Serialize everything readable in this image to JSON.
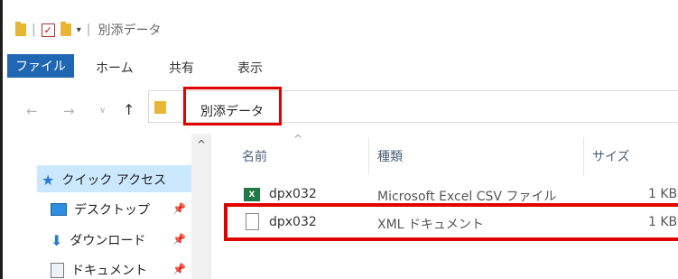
{
  "window": {
    "title": "別添データ"
  },
  "ribbon": {
    "tabs": [
      "ファイル",
      "ホーム",
      "共有",
      "表示"
    ]
  },
  "address": {
    "path": "別添データ"
  },
  "nav": {
    "items": [
      {
        "label": "クイック アクセス"
      },
      {
        "label": "デスクトップ"
      },
      {
        "label": "ダウンロード"
      },
      {
        "label": "ドキュメント"
      }
    ]
  },
  "files": {
    "columns": [
      "名前",
      "種類",
      "サイズ"
    ],
    "rows": [
      {
        "name": "dpx032",
        "type": "Microsoft Excel CSV ファイル",
        "size": "1 KB"
      },
      {
        "name": "dpx032",
        "type": "XML ドキュメント",
        "size": "1 KB"
      }
    ]
  },
  "colors": {
    "accent": "#1f66b3",
    "highlight": "#e00000",
    "selection": "#cce8ff"
  },
  "icons": [
    "folder-icon",
    "checkmark-icon",
    "dropdown-icon",
    "back-icon",
    "forward-icon",
    "recent-icon",
    "up-icon",
    "star-icon",
    "desktop-icon",
    "download-icon",
    "document-icon",
    "pin-icon",
    "excel-icon",
    "file-icon"
  ]
}
